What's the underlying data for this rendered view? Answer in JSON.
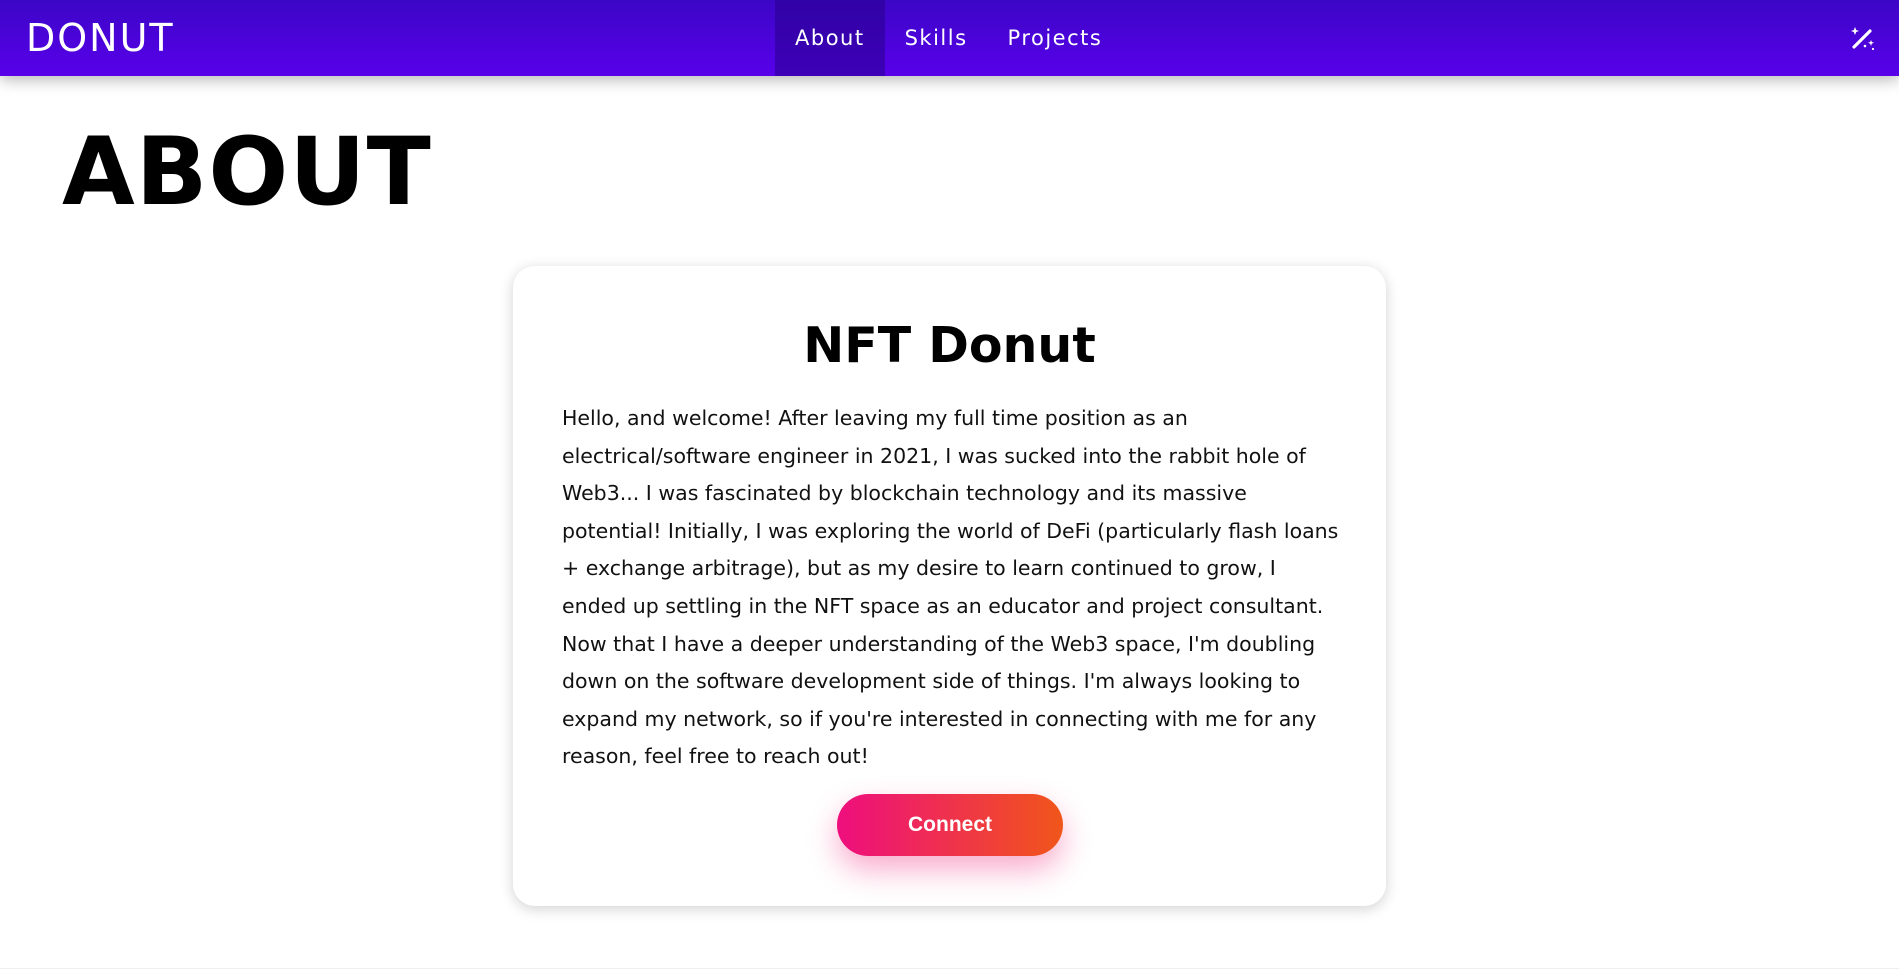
{
  "navbar": {
    "brand": "DONUT",
    "links": [
      {
        "label": "About",
        "active": true
      },
      {
        "label": "Skills",
        "active": false
      },
      {
        "label": "Projects",
        "active": false
      }
    ],
    "theme_toggle_icon": "magic-wand-icon"
  },
  "main": {
    "section_title": "ABOUT",
    "card": {
      "title": "NFT Donut",
      "body": "Hello, and welcome! After leaving my full time position as an electrical/software engineer in 2021, I was sucked into the rabbit hole of Web3... I was fascinated by blockchain technology and its massive potential! Initially, I was exploring the world of DeFi (particularly flash loans + exchange arbitrage), but as my desire to learn continued to grow, I ended up settling in the NFT space as an educator and project consultant. Now that I have a deeper understanding of the Web3 space, I'm doubling down on the software development side of things. I'm always looking to expand my network, so if you're interested in connecting with me for any reason, feel free to reach out!",
      "button_label": "Connect"
    }
  },
  "colors": {
    "navbar_top": "#3c06c6",
    "navbar_bottom": "#5800ea",
    "button_gradient_start": "#ee0e7e",
    "button_gradient_end": "#f0561a"
  }
}
